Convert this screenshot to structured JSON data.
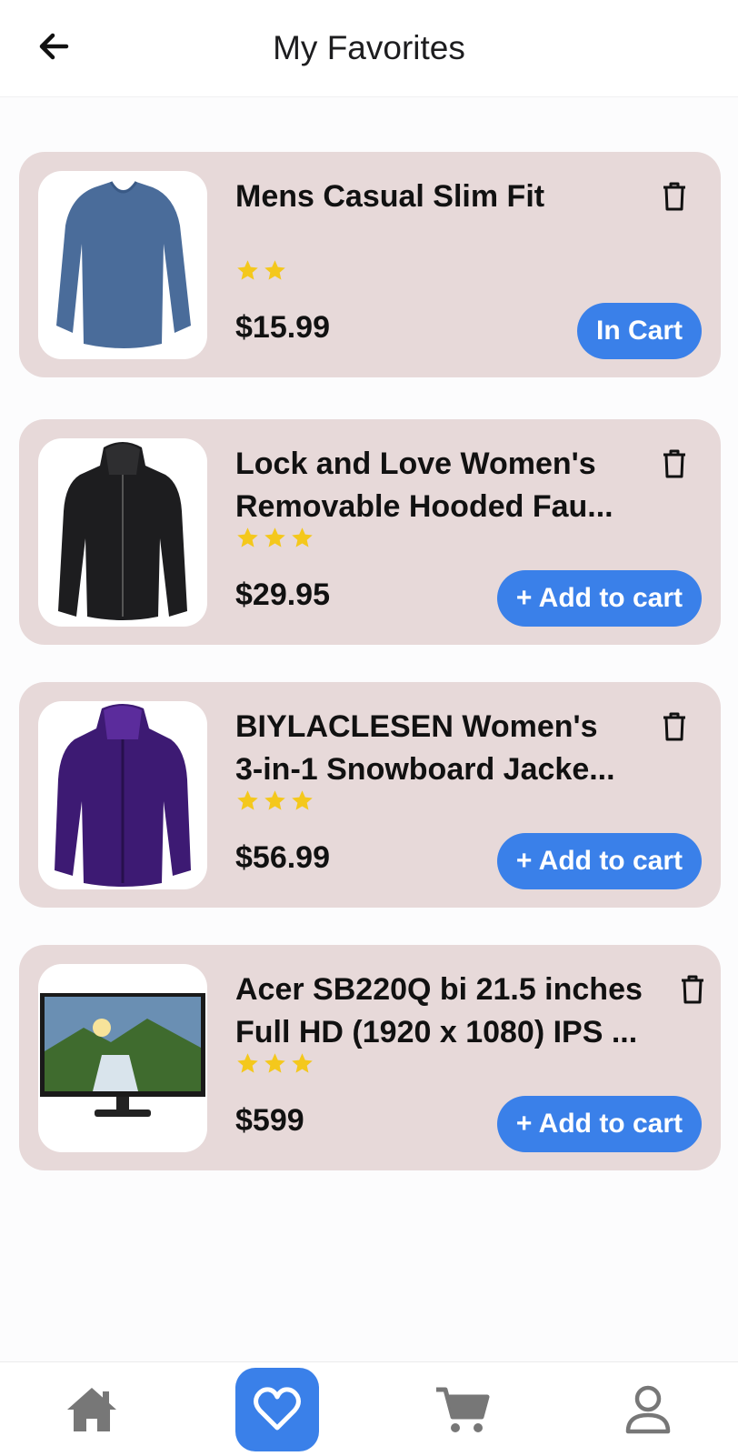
{
  "header": {
    "title": "My Favorites",
    "back_icon": "arrow-left-icon"
  },
  "favorites": [
    {
      "name_line1": "Mens Casual Slim Fit",
      "name_line2": "",
      "rating": 2,
      "price": "$15.99",
      "button": "In Cart",
      "image": "blue-long-sleeve-shirt"
    },
    {
      "name_line1": "Lock and Love Women's",
      "name_line2": "Removable Hooded Fau...",
      "rating": 3,
      "price": "$29.95",
      "button": "+ Add to cart",
      "image": "black-hooded-jacket"
    },
    {
      "name_line1": "BIYLACLESEN Women's",
      "name_line2": "3-in-1 Snowboard Jacke...",
      "rating": 3,
      "price": "$56.99",
      "button": "+ Add to cart",
      "image": "purple-snowboard-jacket"
    },
    {
      "name_line1": "Acer SB220Q bi 21.5 inches",
      "name_line2": "Full HD (1920 x 1080) IPS ...",
      "rating": 3,
      "price": "$599",
      "button": "+ Add to cart",
      "image": "acer-monitor"
    }
  ],
  "nav": {
    "items": [
      {
        "icon": "home-icon",
        "active": false
      },
      {
        "icon": "heart-icon",
        "active": true
      },
      {
        "icon": "cart-icon",
        "active": false
      },
      {
        "icon": "user-icon",
        "active": false
      }
    ]
  },
  "colors": {
    "accent": "#3a80e9",
    "card": "#e7d9d9",
    "star": "#f4c81c"
  }
}
